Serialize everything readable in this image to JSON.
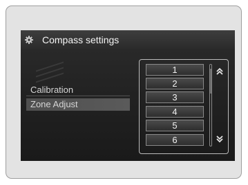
{
  "header": {
    "title": "Compass settings",
    "icon": "gear-icon"
  },
  "menu": {
    "items": [
      {
        "label": "Calibration",
        "selected": false
      },
      {
        "label": "Zone Adjust",
        "selected": true
      }
    ]
  },
  "zone_list": {
    "options": [
      "1",
      "2",
      "3",
      "4",
      "5",
      "6"
    ],
    "scroll_up_icon": "double-chevron-up-icon",
    "scroll_down_icon": "double-chevron-down-icon"
  },
  "colors": {
    "screen_background": "#222222",
    "selected_item": "#555555",
    "text": "#f2f2f2"
  }
}
